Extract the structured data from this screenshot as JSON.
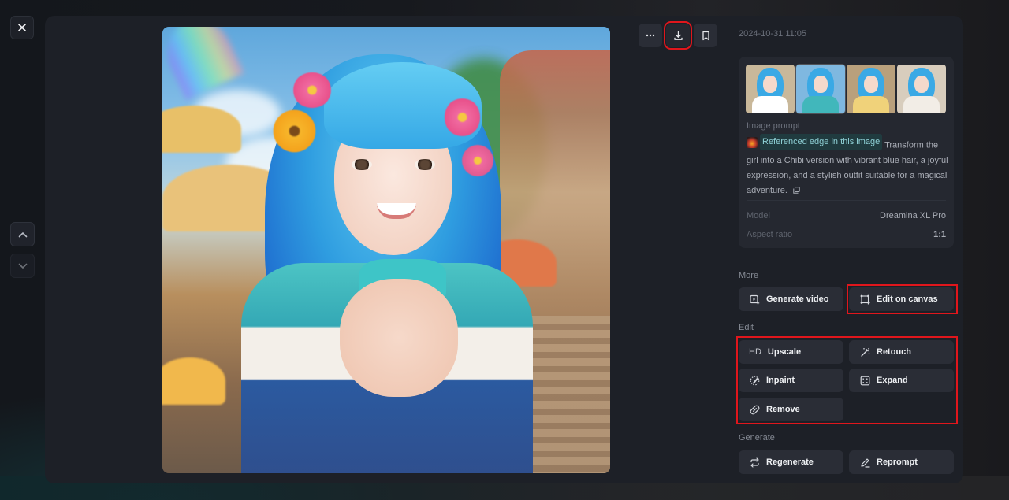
{
  "nav": {
    "close_icon": "close-icon",
    "prev_icon": "chevron-up-icon",
    "next_icon": "chevron-down-icon"
  },
  "main_image": {
    "alt": "Smiling girl with vibrant blue hair, flowers in hair, teal outfit, sunny village background"
  },
  "toolbar": {
    "more_icon": "more-horizontal-icon",
    "download_icon": "download-icon",
    "bookmark_icon": "bookmark-icon"
  },
  "details": {
    "timestamp": "2024-10-31 11:05",
    "thumbnails": [
      {
        "alt": "Variation 1 - street scene",
        "selected": false,
        "bg": "#c9b89a",
        "body": "#ffffff"
      },
      {
        "alt": "Variation 2 - sunny village",
        "selected": true,
        "bg": "#7fb8e0",
        "body": "#41b7bb"
      },
      {
        "alt": "Variation 3 - city skyline",
        "selected": false,
        "bg": "#b9a07c",
        "body": "#f0d27a"
      },
      {
        "alt": "Variation 4 - indoor",
        "selected": false,
        "bg": "#d8cdbd",
        "body": "#f2ede6"
      }
    ],
    "prompt_label": "Image prompt",
    "reference_chip": "Referenced edge in this image",
    "prompt_text": "Transform the girl into a Chibi version with vibrant blue hair, a joyful expression, and a stylish outfit suitable for a magical adventure.",
    "copy_icon": "copy-icon",
    "model_label": "Model",
    "model_value": "Dreamina XL Pro",
    "ratio_label": "Aspect ratio",
    "ratio_value": "1:1"
  },
  "sections": {
    "more": {
      "label": "More",
      "buttons": [
        {
          "label": "Generate video",
          "icon": "video-add-icon"
        },
        {
          "label": "Edit on canvas",
          "icon": "canvas-icon"
        }
      ]
    },
    "edit": {
      "label": "Edit",
      "buttons": [
        {
          "label": "Upscale",
          "icon_text": "HD"
        },
        {
          "label": "Retouch",
          "icon": "magic-wand-icon"
        },
        {
          "label": "Inpaint",
          "icon": "brush-icon"
        },
        {
          "label": "Expand",
          "icon": "expand-icon"
        },
        {
          "label": "Remove",
          "icon": "eraser-icon"
        }
      ]
    },
    "generate": {
      "label": "Generate",
      "buttons": [
        {
          "label": "Regenerate",
          "icon": "repeat-icon"
        },
        {
          "label": "Reprompt",
          "icon": "pencil-icon"
        }
      ]
    }
  },
  "highlight_color": "#e0161c"
}
